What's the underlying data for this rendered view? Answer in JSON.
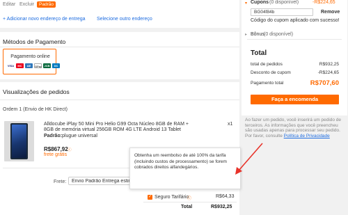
{
  "address": {
    "edit": "Editar",
    "delete": "Excluir",
    "default_tag": "Padrão",
    "add_new": "+ Adicionar novo endereço de entrega",
    "select_other": "Selecione outro endereço"
  },
  "payment": {
    "title": "Métodos de Pagamento",
    "online_label": "Pagamento online",
    "cards": [
      "VISA",
      "MC",
      "AE",
      "GPay",
      "JCB",
      "DC",
      "ELO"
    ]
  },
  "order_view": {
    "title": "Visualizações de pedidos",
    "order_header": "Ordem 1 (Envio de HK Direct)",
    "product_name_line1": "Alldocube iPlay 50 Mini Pro Helio G99 Octa Núcleo 8GB de RAM +",
    "product_name_line2": "8GB de memória virtual 256GB ROM 4G LTE Android 13 Tablet",
    "variant_label": "Padrão:",
    "variant_value": "plugue universal",
    "quantity": "x1",
    "price": "R$867,92",
    "free_shipping": "frete grátis",
    "freight_label": "Frete:",
    "freight_option": "Envio Padrão Entrega estima",
    "shipping_cost": "R$64,33",
    "insurance_label": "Seguro Tarifário",
    "total_label": "Total",
    "total_value": "R$932,25"
  },
  "tooltip": {
    "text": "Obtenha um reembolso de até 100% da tarifa (incluindo custos de processamento) se forem cobrados direitos alfandegários."
  },
  "summary": {
    "coupons_label": "Cupons",
    "coupons_count": "(0 disponível)",
    "coupons_value": "-R$224,65",
    "coupon_code": "BG04f84b",
    "remove_label": "Remove",
    "coupon_success": "Código do cupom aplicado com sucesso!",
    "bonus_label": "Bônus",
    "bonus_count": "(0 disponível)",
    "total_title": "Total",
    "lines": [
      {
        "label": "total de pedidos",
        "value": "R$932,25"
      },
      {
        "label": "Desconto de cupom",
        "value": "-R$224,65"
      }
    ],
    "payment_label": "Pagamento total",
    "payment_value": "R$707,60",
    "place_order": "Faça a encomenda",
    "privacy_note": "Ao fazer um pedido, você inserirá um pedido de terceiros. As informações que você preencheu são usadas apenas para processar seu pedido. Por favor, consulte",
    "privacy_link": "Política de Privacidade"
  },
  "colors": {
    "accent": "#ff6a00",
    "link": "#1d6ce0",
    "annotation_arrow": "#e8332a"
  }
}
